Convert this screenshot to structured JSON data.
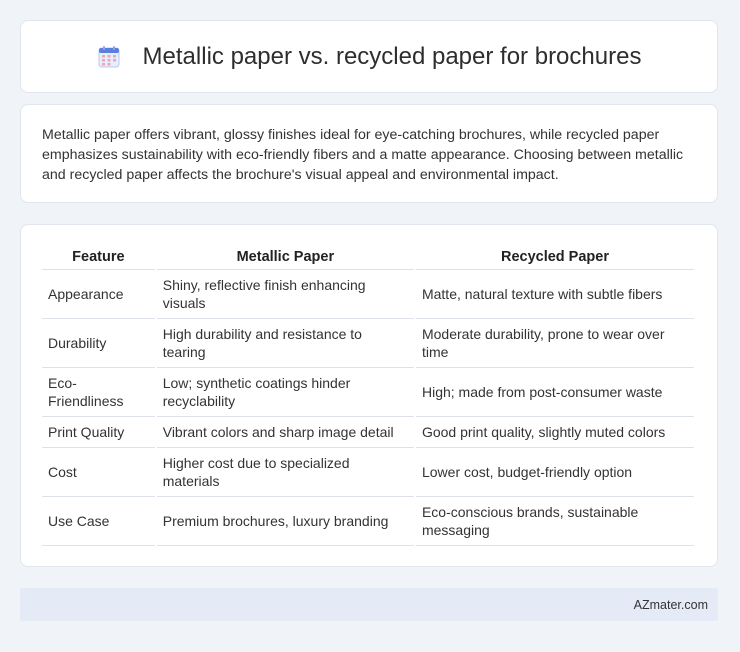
{
  "header": {
    "title": "Metallic paper vs. recycled paper for brochures",
    "icon": "calendar-icon",
    "icon_color": "#5b7fe0"
  },
  "description": "Metallic paper offers vibrant, glossy finishes ideal for eye-catching brochures, while recycled paper emphasizes sustainability with eco-friendly fibers and a matte appearance. Choosing between metallic and recycled paper affects the brochure's visual appeal and environmental impact.",
  "table": {
    "headers": [
      "Feature",
      "Metallic Paper",
      "Recycled Paper"
    ],
    "rows": [
      [
        "Appearance",
        "Shiny, reflective finish enhancing visuals",
        "Matte, natural texture with subtle fibers"
      ],
      [
        "Durability",
        "High durability and resistance to tearing",
        "Moderate durability, prone to wear over time"
      ],
      [
        "Eco-Friendliness",
        "Low; synthetic coatings hinder recyclability",
        "High; made from post-consumer waste"
      ],
      [
        "Print Quality",
        "Vibrant colors and sharp image detail",
        "Good print quality, slightly muted colors"
      ],
      [
        "Cost",
        "Higher cost due to specialized materials",
        "Lower cost, budget-friendly option"
      ],
      [
        "Use Case",
        "Premium brochures, luxury branding",
        "Eco-conscious brands, sustainable messaging"
      ]
    ]
  },
  "footer": {
    "site": "AZmater.com"
  }
}
